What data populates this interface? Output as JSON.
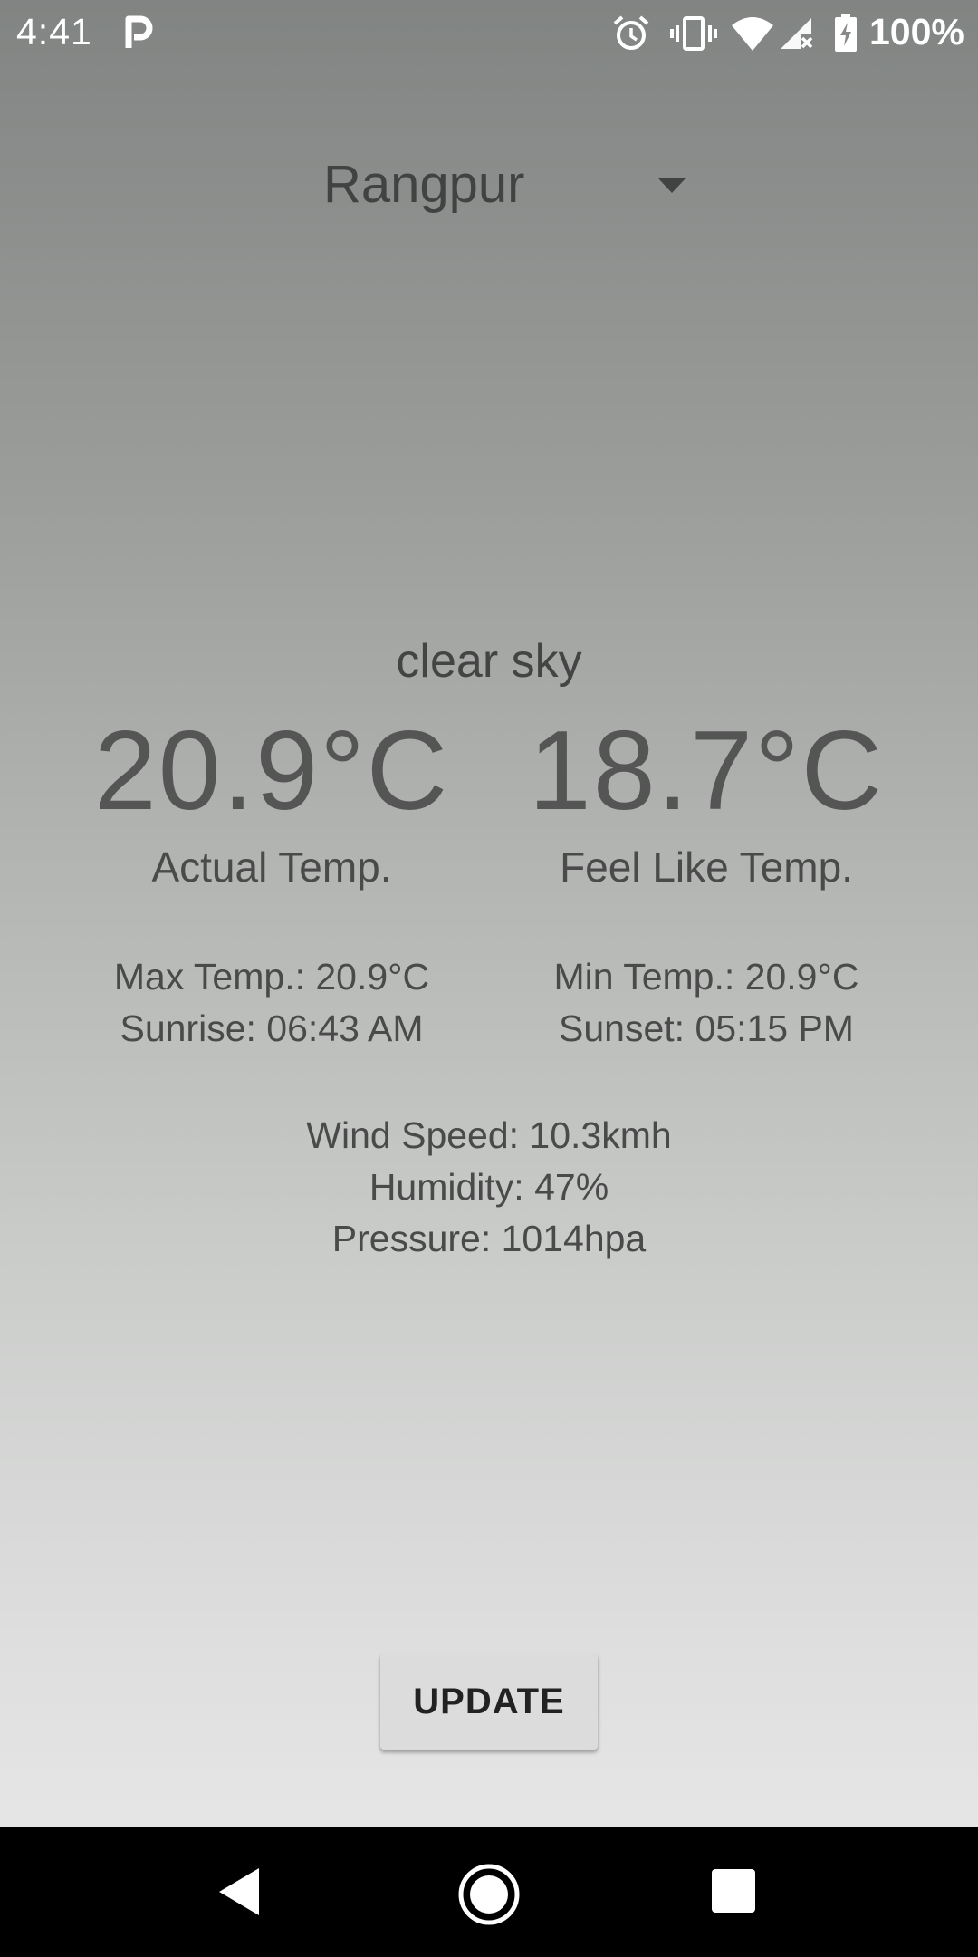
{
  "status_bar": {
    "time": "4:41",
    "battery_level": "100%",
    "icons": [
      "parking-icon",
      "alarm-icon",
      "vibrate-icon",
      "wifi-icon",
      "signal-icon",
      "battery-charging-icon"
    ]
  },
  "city_selector": {
    "selected": "Rangpur"
  },
  "weather": {
    "condition": "clear sky",
    "actual_temp": "20.9°C",
    "actual_temp_label": "Actual Temp.",
    "feels_like_temp": "18.7°C",
    "feels_like_label": "Feel Like Temp.",
    "max_temp": "Max Temp.: 20.9°C",
    "min_temp": "Min Temp.: 20.9°C",
    "sunrise": "Sunrise: 06:43 AM",
    "sunset": "Sunset: 05:15 PM",
    "wind_speed": "Wind Speed: 10.3kmh",
    "humidity": "Humidity: 47%",
    "pressure": "Pressure: 1014hpa"
  },
  "actions": {
    "update_label": "UPDATE"
  },
  "colors": {
    "gradient_top": "#818482",
    "gradient_bottom": "#ebebeb",
    "text": "#4a4a4a",
    "button": "#dcdcdc"
  }
}
